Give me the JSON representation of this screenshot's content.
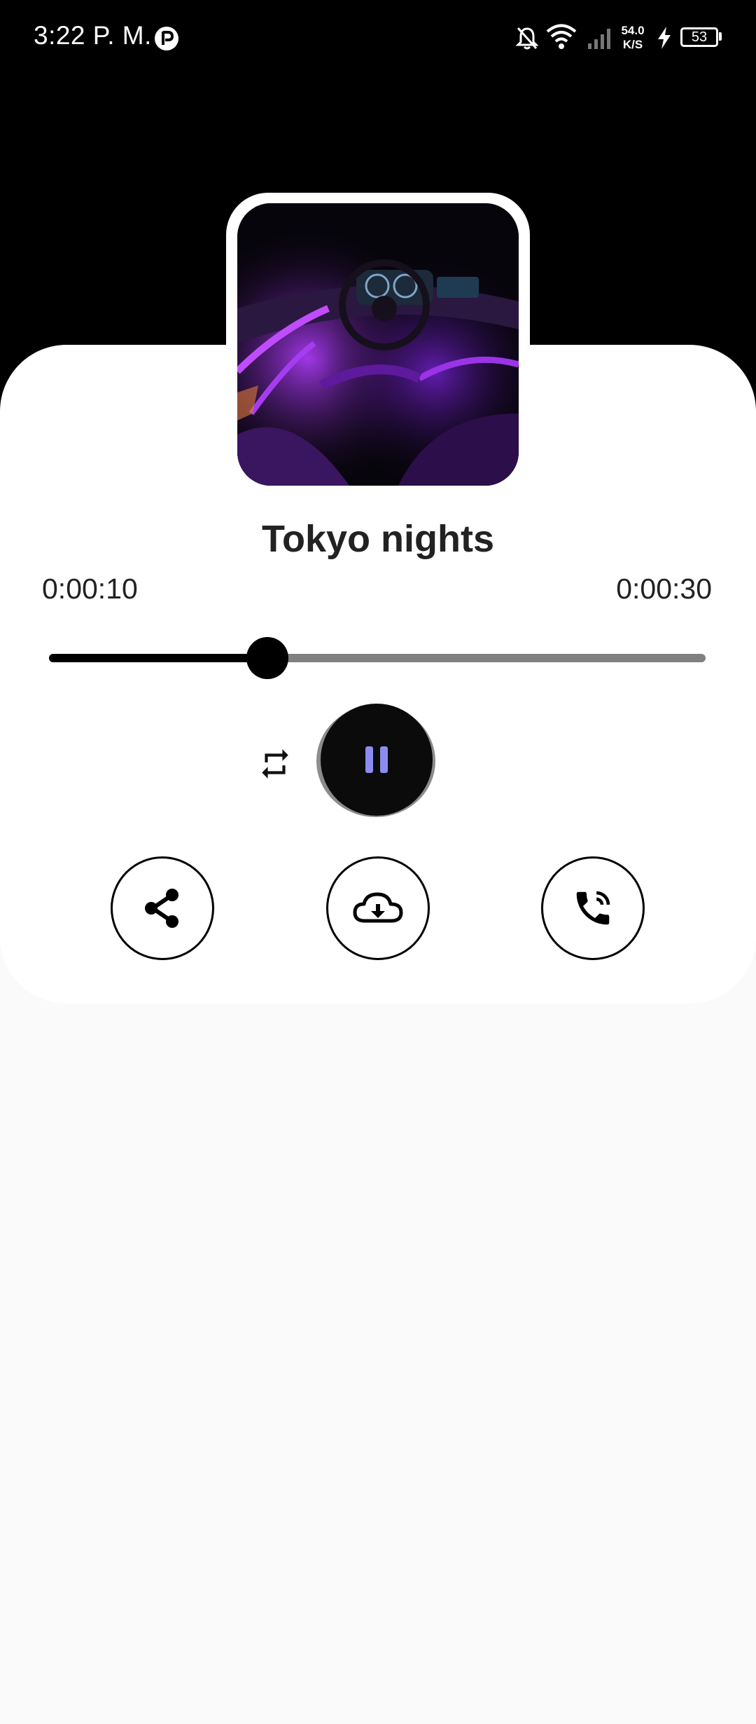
{
  "status_bar": {
    "time": "3:22 P. M.",
    "net_speed_value": "54.0",
    "net_speed_unit": "K/S",
    "battery": "53",
    "icons": [
      "app-notification-icon",
      "bell-off-icon",
      "wifi-icon",
      "signal-icon",
      "charging-icon",
      "battery-icon"
    ]
  },
  "player": {
    "track_title": "Tokyo nights",
    "elapsed": "0:00:10",
    "duration": "0:00:30",
    "progress_fraction": 0.333,
    "state": "playing"
  },
  "controls": {
    "repeat_icon": "repeat-icon",
    "pause_icon": "pause-icon",
    "pause_icon_color": "#8c8cf0"
  },
  "actions": [
    {
      "name": "share",
      "icon": "share-icon"
    },
    {
      "name": "download",
      "icon": "cloud-download-icon"
    },
    {
      "name": "call",
      "icon": "phone-call-icon"
    }
  ],
  "colors": {
    "background": "#fafafa",
    "header": "#000000",
    "card": "#ffffff",
    "slider_active": "#000000",
    "slider_inactive": "#808080"
  }
}
